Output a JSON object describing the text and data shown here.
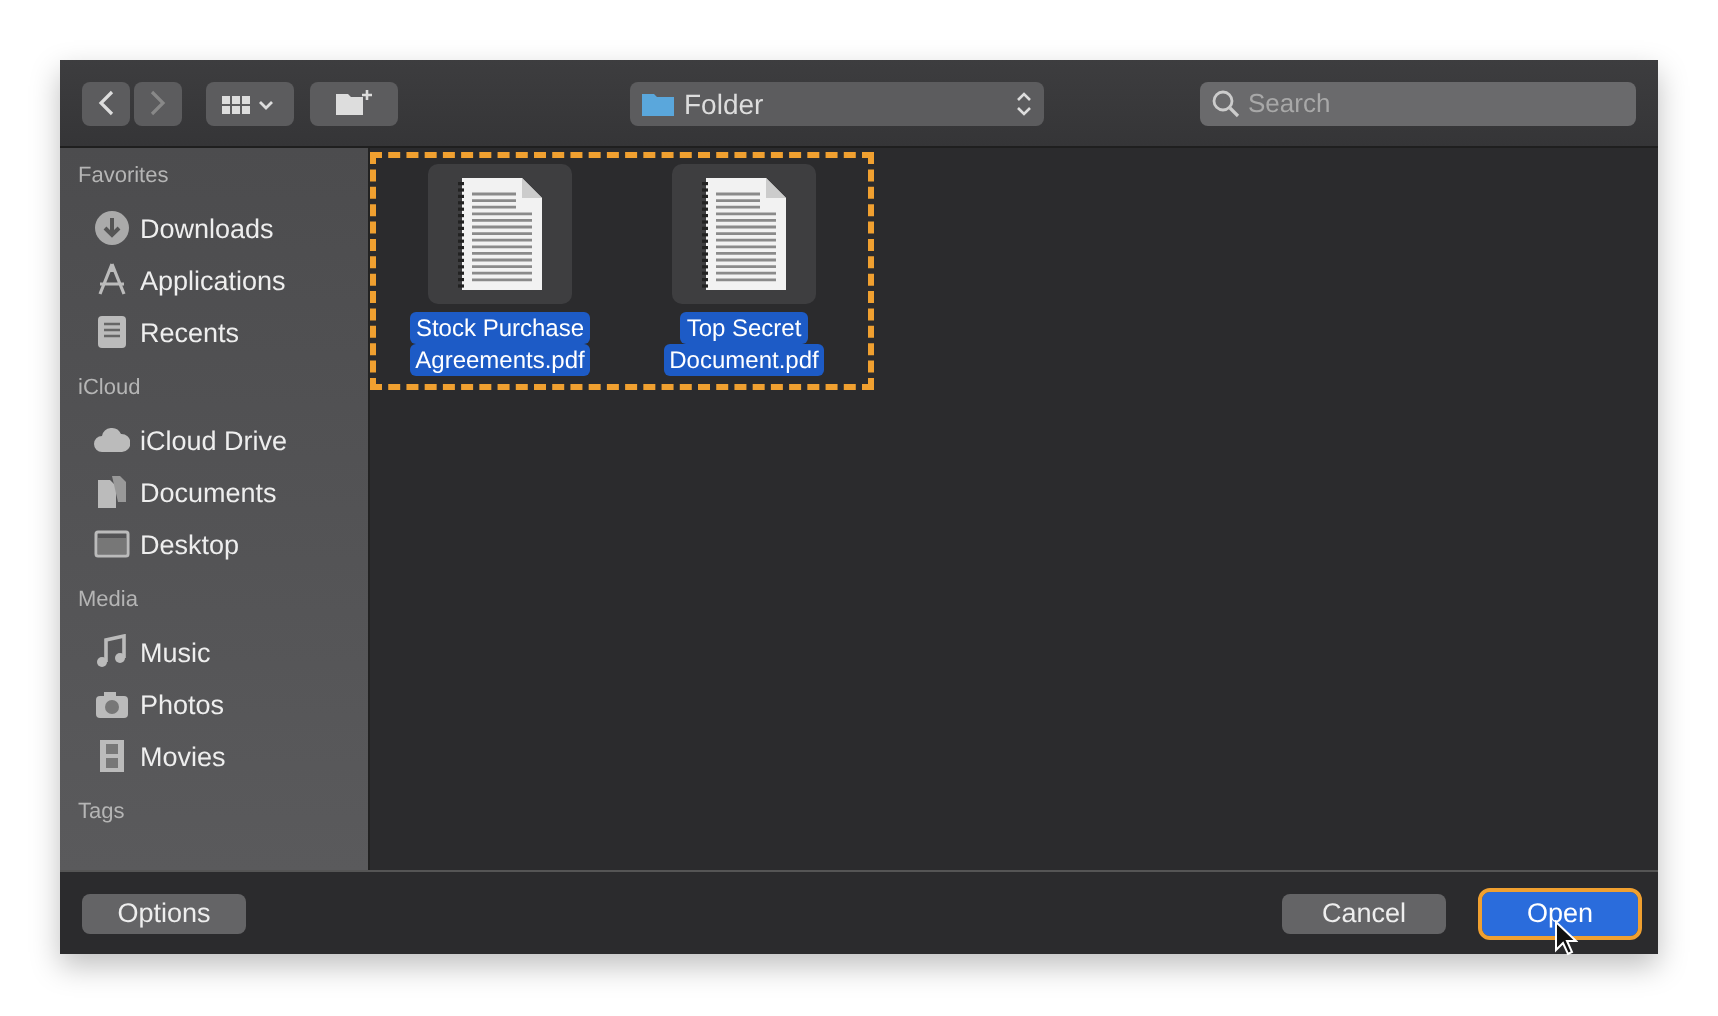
{
  "toolbar": {
    "location": "Folder",
    "search": {
      "placeholder": "Search"
    }
  },
  "sidebar": [
    {
      "title": "Favorites",
      "items": [
        {
          "label": "Downloads"
        },
        {
          "label": "Applications"
        },
        {
          "label": "Recents"
        }
      ]
    },
    {
      "title": "iCloud",
      "items": [
        {
          "label": "iCloud Drive"
        },
        {
          "label": "Documents"
        },
        {
          "label": "Desktop"
        }
      ]
    },
    {
      "title": "Media",
      "items": [
        {
          "label": "Music"
        },
        {
          "label": "Photos"
        },
        {
          "label": "Movies"
        }
      ]
    },
    {
      "title": "Tags"
    }
  ],
  "files": [
    {
      "lines": [
        "Stock Purchase",
        "Agreements.pdf"
      ],
      "selected": true
    },
    {
      "lines": [
        "Top Secret",
        "Document.pdf"
      ],
      "selected": true
    }
  ],
  "files_highlighted": true,
  "buttons": {
    "options": "Options",
    "cancel": "Cancel",
    "open": {
      "label": "Open",
      "highlighted": true
    }
  }
}
